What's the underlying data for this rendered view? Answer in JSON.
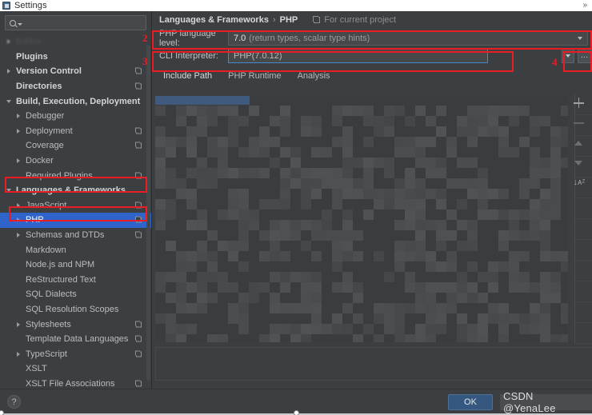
{
  "window": {
    "title": "Settings",
    "icon": "settings-window-icon",
    "chevron": "»"
  },
  "sidebar": {
    "search": {
      "placeholder": "",
      "value": "",
      "icon": "search-icon",
      "caret_icon": "chevron-down-icon"
    },
    "items": [
      {
        "label": "Editor",
        "indent": 0,
        "arrow": "right",
        "bold": true,
        "badge": false,
        "blurred": true,
        "selected": false
      },
      {
        "label": "Plugins",
        "indent": 0,
        "arrow": "none",
        "bold": true,
        "badge": false,
        "blurred": false,
        "selected": false
      },
      {
        "label": "Version Control",
        "indent": 0,
        "arrow": "right",
        "bold": true,
        "badge": true,
        "blurred": false,
        "selected": false
      },
      {
        "label": "Directories",
        "indent": 0,
        "arrow": "none",
        "bold": true,
        "badge": true,
        "blurred": false,
        "selected": false
      },
      {
        "label": "Build, Execution, Deployment",
        "indent": 0,
        "arrow": "down",
        "bold": true,
        "badge": false,
        "blurred": false,
        "selected": false
      },
      {
        "label": "Debugger",
        "indent": 1,
        "arrow": "right",
        "bold": false,
        "badge": false,
        "blurred": false,
        "selected": false
      },
      {
        "label": "Deployment",
        "indent": 1,
        "arrow": "right",
        "bold": false,
        "badge": true,
        "blurred": false,
        "selected": false
      },
      {
        "label": "Coverage",
        "indent": 1,
        "arrow": "none",
        "bold": false,
        "badge": true,
        "blurred": false,
        "selected": false
      },
      {
        "label": "Docker",
        "indent": 1,
        "arrow": "right",
        "bold": false,
        "badge": false,
        "blurred": false,
        "selected": false
      },
      {
        "label": "Required Plugins",
        "indent": 1,
        "arrow": "none",
        "bold": false,
        "badge": true,
        "blurred": false,
        "selected": false
      },
      {
        "label": "Languages & Frameworks",
        "indent": 0,
        "arrow": "down",
        "bold": true,
        "badge": false,
        "blurred": false,
        "selected": false
      },
      {
        "label": "JavaScript",
        "indent": 1,
        "arrow": "right",
        "bold": false,
        "badge": true,
        "blurred": false,
        "selected": false
      },
      {
        "label": "PHP",
        "indent": 1,
        "arrow": "right",
        "bold": false,
        "badge": true,
        "blurred": false,
        "selected": true
      },
      {
        "label": "Schemas and DTDs",
        "indent": 1,
        "arrow": "right",
        "bold": false,
        "badge": true,
        "blurred": false,
        "selected": false
      },
      {
        "label": "Markdown",
        "indent": 1,
        "arrow": "none",
        "bold": false,
        "badge": false,
        "blurred": false,
        "selected": false
      },
      {
        "label": "Node.js and NPM",
        "indent": 1,
        "arrow": "none",
        "bold": false,
        "badge": false,
        "blurred": false,
        "selected": false
      },
      {
        "label": "ReStructured Text",
        "indent": 1,
        "arrow": "none",
        "bold": false,
        "badge": false,
        "blurred": false,
        "selected": false
      },
      {
        "label": "SQL Dialects",
        "indent": 1,
        "arrow": "none",
        "bold": false,
        "badge": false,
        "blurred": false,
        "selected": false
      },
      {
        "label": "SQL Resolution Scopes",
        "indent": 1,
        "arrow": "none",
        "bold": false,
        "badge": false,
        "blurred": false,
        "selected": false
      },
      {
        "label": "Stylesheets",
        "indent": 1,
        "arrow": "right",
        "bold": false,
        "badge": true,
        "blurred": false,
        "selected": false
      },
      {
        "label": "Template Data Languages",
        "indent": 1,
        "arrow": "none",
        "bold": false,
        "badge": true,
        "blurred": false,
        "selected": false
      },
      {
        "label": "TypeScript",
        "indent": 1,
        "arrow": "right",
        "bold": false,
        "badge": true,
        "blurred": false,
        "selected": false
      },
      {
        "label": "XSLT",
        "indent": 1,
        "arrow": "none",
        "bold": false,
        "badge": false,
        "blurred": false,
        "selected": false
      },
      {
        "label": "XSLT File Associations",
        "indent": 1,
        "arrow": "none",
        "bold": false,
        "badge": true,
        "blurred": false,
        "selected": false
      }
    ]
  },
  "content": {
    "breadcrumb": {
      "parent": "Languages & Frameworks",
      "separator": "›",
      "current": "PHP",
      "scope_label": "For current project",
      "scope_icon": "module-scope-icon"
    },
    "language_level": {
      "label": "PHP language level:",
      "value_strong": "7.0",
      "value_dim": "(return types, scalar type hints)",
      "caret_icon": "chevron-down-icon"
    },
    "cli_interpreter": {
      "label": "CLI Interpreter:",
      "value_strong": "PHP",
      "value_dim": "(7.0.12)",
      "dropdown_icon": "chevron-down-icon",
      "browse_label": "…",
      "browse_icon": "ellipsis-icon"
    },
    "tabs": [
      {
        "label": "Include Path",
        "active": true
      },
      {
        "label": "PHP Runtime",
        "active": false
      },
      {
        "label": "Analysis",
        "active": false
      }
    ],
    "toolbar_icons": [
      {
        "name": "add-icon",
        "glyph": "+"
      },
      {
        "name": "remove-icon",
        "glyph": "−"
      },
      {
        "name": "move-up-icon",
        "glyph": "▲"
      },
      {
        "name": "move-down-icon",
        "glyph": "▼"
      },
      {
        "name": "sort-icon",
        "glyph": "↓ᴀᶻ"
      }
    ]
  },
  "footer": {
    "help_label": "?",
    "help_icon": "help-icon",
    "ok_label": "OK",
    "watermark": "CSDN @YenaLee"
  },
  "annotations": [
    {
      "number": "2",
      "target": "php-language-level-row"
    },
    {
      "number": "3",
      "target": "cli-interpreter-row"
    },
    {
      "number": "4",
      "target": "cli-interpreter-dropdown"
    }
  ],
  "colors": {
    "accent_blue": "#2f65ca",
    "focus_blue": "#4a88c7",
    "annotation_red": "#ec1c24",
    "ok_button": "#365880",
    "panel_bg": "#3c3f41",
    "field_bg": "#45494a"
  }
}
